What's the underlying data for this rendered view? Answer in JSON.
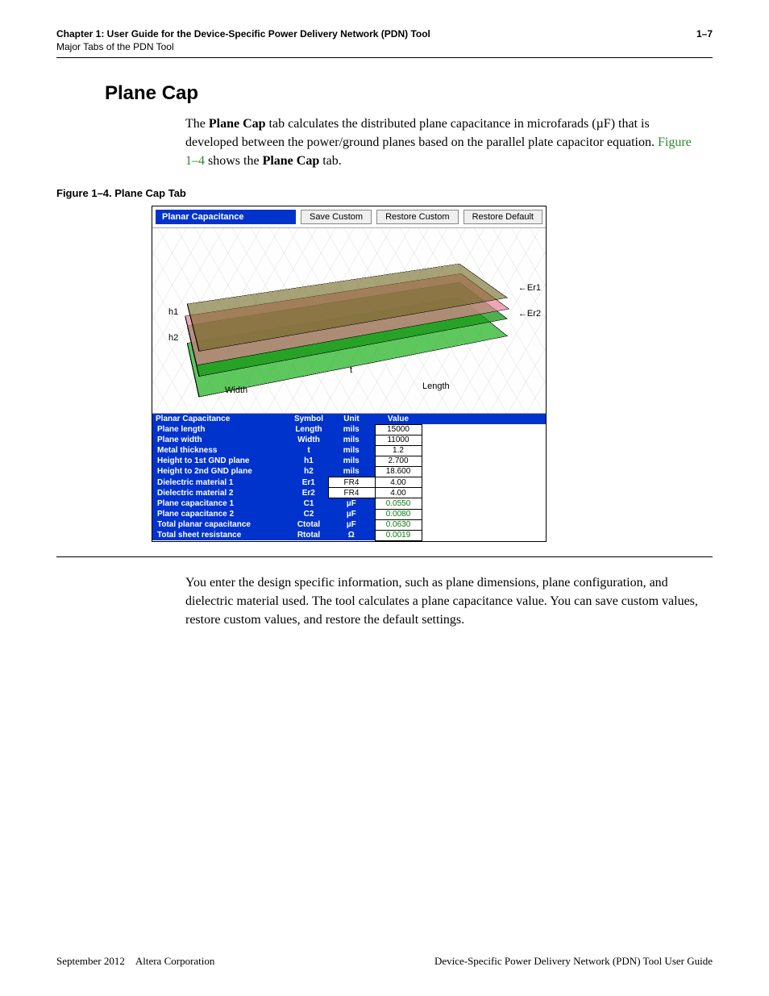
{
  "header": {
    "chapter": "Chapter 1:  User Guide for the Device-Specific Power Delivery Network (PDN) Tool",
    "subtitle": "Major Tabs of the PDN Tool",
    "page_num": "1–7"
  },
  "section": {
    "title": "Plane Cap",
    "para1_a": "The ",
    "para1_b": "Plane Cap",
    "para1_c": " tab calculates the distributed plane capacitance in microfarads (µF) that is developed between the power/ground planes based on the parallel plate capacitor equation. ",
    "para1_link": "Figure 1–4",
    "para1_d": " shows the ",
    "para1_e": "Plane Cap",
    "para1_f": " tab.",
    "para2": "You enter the design specific information, such as plane dimensions, plane configuration, and dielectric material used. The tool calculates a plane capacitance value. You can save custom values, restore custom values, and restore the default settings."
  },
  "figure": {
    "caption": "Figure 1–4.  Plane Cap Tab",
    "panel_title": "Planar Capacitance",
    "buttons": {
      "save": "Save Custom",
      "restore_custom": "Restore Custom",
      "restore_default": "Restore Default"
    },
    "diagram_labels": {
      "h1": "h1",
      "h2": "h2",
      "width": "Width",
      "length": "Length",
      "t": "t",
      "er1": "Er1",
      "er2": "Er2"
    },
    "table": {
      "headers": {
        "c0": "Planar Capacitance",
        "c1": "Symbol",
        "c2": "Unit",
        "c3": "Value"
      },
      "rows": [
        {
          "label": "Plane length",
          "symbol": "Length",
          "unit": "mils",
          "value": "15000",
          "unit_white": false,
          "green": false
        },
        {
          "label": "Plane width",
          "symbol": "Width",
          "unit": "mils",
          "value": "11000",
          "unit_white": false,
          "green": false
        },
        {
          "label": "Metal thickness",
          "symbol": "t",
          "unit": "mils",
          "value": "1.2",
          "unit_white": false,
          "green": false
        },
        {
          "label": "Height to 1st GND plane",
          "symbol": "h1",
          "unit": "mils",
          "value": "2.700",
          "unit_white": false,
          "green": false
        },
        {
          "label": "Height to 2nd GND plane",
          "symbol": "h2",
          "unit": "mils",
          "value": "18.600",
          "unit_white": false,
          "green": false
        },
        {
          "label": "Dielectric material 1",
          "symbol": "Er1",
          "unit": "FR4",
          "value": "4.00",
          "unit_white": true,
          "green": false
        },
        {
          "label": "Dielectric material 2",
          "symbol": "Er2",
          "unit": "FR4",
          "value": "4.00",
          "unit_white": true,
          "green": false
        },
        {
          "label": "Plane capacitance 1",
          "symbol": "C1",
          "unit": "µF",
          "value": "0.0550",
          "unit_white": false,
          "green": true
        },
        {
          "label": "Plane capacitance 2",
          "symbol": "C2",
          "unit": "µF",
          "value": "0.0080",
          "unit_white": false,
          "green": true
        },
        {
          "label": "Total planar capacitance",
          "symbol": "Ctotal",
          "unit": "µF",
          "value": "0.0630",
          "unit_white": false,
          "green": true
        },
        {
          "label": "Total sheet resistance",
          "symbol": "Rtotal",
          "unit": "Ω",
          "value": "0.0019",
          "unit_white": false,
          "green": true
        }
      ]
    }
  },
  "footer": {
    "left": "September 2012 Altera Corporation",
    "right": "Device-Specific Power Delivery Network (PDN) Tool User Guide"
  }
}
